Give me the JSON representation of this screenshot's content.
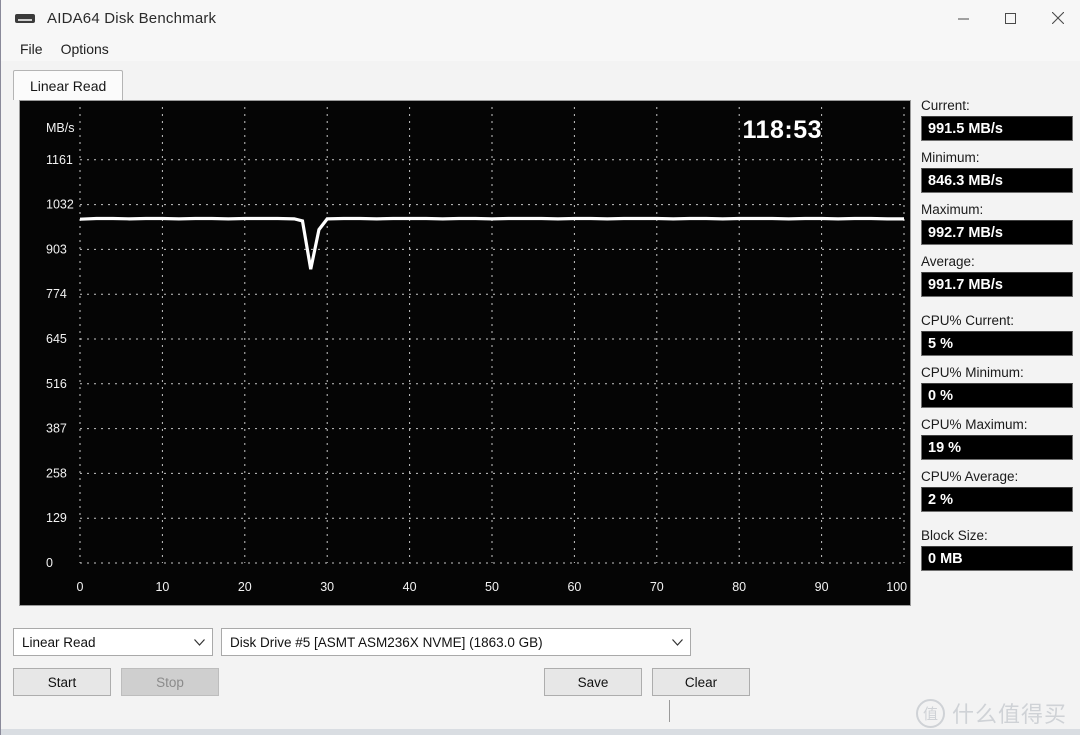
{
  "window": {
    "title": "AIDA64 Disk Benchmark",
    "icon": "disk-drive-icon",
    "minimize": "─",
    "maximize": "❐",
    "close": "✕"
  },
  "menu": {
    "items": [
      {
        "label": "File"
      },
      {
        "label": "Options"
      }
    ]
  },
  "tabs": [
    {
      "label": "Linear Read",
      "active": true
    }
  ],
  "chart_data": {
    "type": "line",
    "title": "",
    "timer": "118:53",
    "xlabel": "%",
    "ylabel": "MB/s",
    "x_ticks": [
      "0",
      "10",
      "20",
      "30",
      "40",
      "50",
      "60",
      "70",
      "80",
      "90",
      "100 %"
    ],
    "x_values": [
      0,
      10,
      20,
      30,
      40,
      50,
      60,
      70,
      80,
      90,
      100
    ],
    "y_ticks": [
      "0",
      "129",
      "258",
      "387",
      "516",
      "645",
      "774",
      "903",
      "1032",
      "1161"
    ],
    "y_values": [
      0,
      129,
      258,
      387,
      516,
      645,
      774,
      903,
      1032,
      1161
    ],
    "ylim": [
      0,
      1290
    ],
    "xlim": [
      0,
      100
    ],
    "grid": true,
    "grid_style": "dotted",
    "background": "#050505",
    "line_color": "#ffffff",
    "series": [
      {
        "name": "Linear Read",
        "x": [
          0,
          2,
          4,
          6,
          8,
          10,
          12,
          14,
          16,
          18,
          20,
          22,
          24,
          26,
          27,
          28,
          29,
          30,
          32,
          34,
          36,
          38,
          40,
          42,
          44,
          46,
          48,
          50,
          52,
          54,
          56,
          58,
          60,
          62,
          64,
          66,
          68,
          70,
          72,
          74,
          76,
          78,
          80,
          82,
          84,
          86,
          88,
          90,
          92,
          94,
          96,
          98,
          100
        ],
        "values": [
          990,
          992,
          992,
          991,
          992,
          992,
          991,
          992,
          992,
          991,
          992,
          992,
          992,
          991,
          985,
          846,
          960,
          991,
          992,
          992,
          991,
          992,
          992,
          992,
          991,
          992,
          992,
          991,
          992,
          992,
          992,
          991,
          992,
          992,
          991,
          992,
          992,
          992,
          991,
          992,
          992,
          991,
          992,
          992,
          992,
          991,
          992,
          992,
          991,
          992,
          992,
          991,
          991
        ]
      }
    ]
  },
  "stats": [
    {
      "label": "Current:",
      "value": "991.5 MB/s",
      "gap": false
    },
    {
      "label": "Minimum:",
      "value": "846.3 MB/s",
      "gap": false
    },
    {
      "label": "Maximum:",
      "value": "992.7 MB/s",
      "gap": false
    },
    {
      "label": "Average:",
      "value": "991.7 MB/s",
      "gap": false
    },
    {
      "label": "CPU% Current:",
      "value": "5 %",
      "gap": true
    },
    {
      "label": "CPU% Minimum:",
      "value": "0 %",
      "gap": false
    },
    {
      "label": "CPU% Maximum:",
      "value": "19 %",
      "gap": false
    },
    {
      "label": "CPU% Average:",
      "value": "2 %",
      "gap": false
    },
    {
      "label": "Block Size:",
      "value": "0 MB",
      "gap": true
    }
  ],
  "controls": {
    "mode_combo": {
      "value": "Linear Read",
      "chevron": "∨"
    },
    "drive_combo": {
      "value": "Disk Drive #5  [ASMT   ASM236X NVME]  (1863.0 GB)",
      "chevron": "∨"
    },
    "start_button": "Start",
    "stop_button": "Stop",
    "save_button": "Save",
    "clear_button": "Clear"
  },
  "watermark": {
    "logo": "值",
    "text": "什么值得买"
  }
}
